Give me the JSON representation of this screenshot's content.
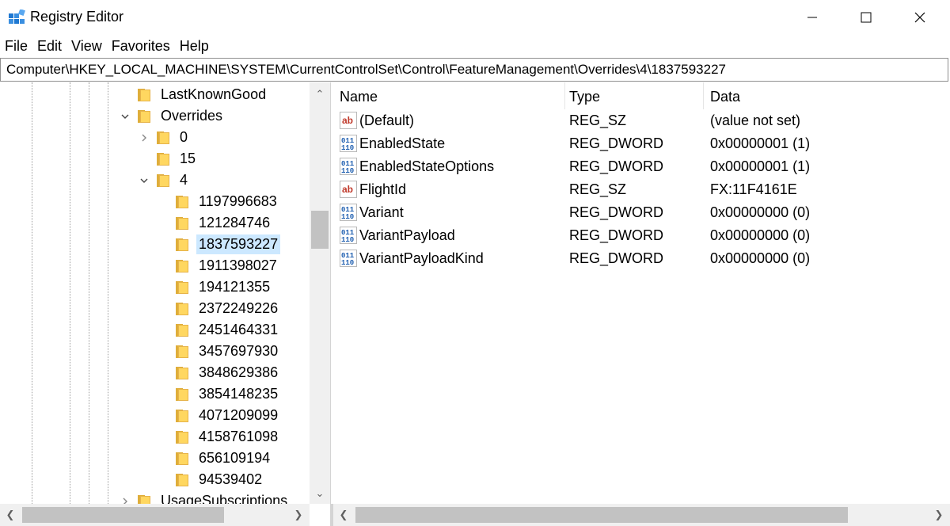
{
  "window": {
    "title": "Registry Editor",
    "minimize_label": "minimize",
    "maximize_label": "maximize",
    "close_label": "close"
  },
  "menu": [
    "File",
    "Edit",
    "View",
    "Favorites",
    "Help"
  ],
  "address": "Computer\\HKEY_LOCAL_MACHINE\\SYSTEM\\CurrentControlSet\\Control\\FeatureManagement\\Overrides\\4\\1837593227",
  "tree": {
    "items": [
      {
        "label": "LastKnownGood",
        "level": 1,
        "expander": "",
        "selected": false
      },
      {
        "label": "Overrides",
        "level": 1,
        "expander": "expanded",
        "selected": false
      },
      {
        "label": "0",
        "level": 2,
        "expander": "collapsed",
        "selected": false
      },
      {
        "label": "15",
        "level": 2,
        "expander": "",
        "selected": false
      },
      {
        "label": "4",
        "level": 2,
        "expander": "expanded",
        "selected": false
      },
      {
        "label": "1197996683",
        "level": 3,
        "expander": "",
        "selected": false
      },
      {
        "label": "121284746",
        "level": 3,
        "expander": "",
        "selected": false
      },
      {
        "label": "1837593227",
        "level": 3,
        "expander": "",
        "selected": true
      },
      {
        "label": "1911398027",
        "level": 3,
        "expander": "",
        "selected": false
      },
      {
        "label": "194121355",
        "level": 3,
        "expander": "",
        "selected": false
      },
      {
        "label": "2372249226",
        "level": 3,
        "expander": "",
        "selected": false
      },
      {
        "label": "2451464331",
        "level": 3,
        "expander": "",
        "selected": false
      },
      {
        "label": "3457697930",
        "level": 3,
        "expander": "",
        "selected": false
      },
      {
        "label": "3848629386",
        "level": 3,
        "expander": "",
        "selected": false
      },
      {
        "label": "3854148235",
        "level": 3,
        "expander": "",
        "selected": false
      },
      {
        "label": "4071209099",
        "level": 3,
        "expander": "",
        "selected": false
      },
      {
        "label": "4158761098",
        "level": 3,
        "expander": "",
        "selected": false
      },
      {
        "label": "656109194",
        "level": 3,
        "expander": "",
        "selected": false
      },
      {
        "label": "94539402",
        "level": 3,
        "expander": "",
        "selected": false
      },
      {
        "label": "UsageSubscriptions",
        "level": 1,
        "expander": "collapsed",
        "selected": false
      }
    ]
  },
  "values": {
    "columns": [
      "Name",
      "Type",
      "Data"
    ],
    "rows": [
      {
        "icon": "string-value-icon",
        "name": "(Default)",
        "type": "REG_SZ",
        "data": "(value not set)"
      },
      {
        "icon": "binary-value-icon",
        "name": "EnabledState",
        "type": "REG_DWORD",
        "data": "0x00000001 (1)"
      },
      {
        "icon": "binary-value-icon",
        "name": "EnabledStateOptions",
        "type": "REG_DWORD",
        "data": "0x00000001 (1)"
      },
      {
        "icon": "string-value-icon",
        "name": "FlightId",
        "type": "REG_SZ",
        "data": "FX:11F4161E"
      },
      {
        "icon": "binary-value-icon",
        "name": "Variant",
        "type": "REG_DWORD",
        "data": "0x00000000 (0)"
      },
      {
        "icon": "binary-value-icon",
        "name": "VariantPayload",
        "type": "REG_DWORD",
        "data": "0x00000000 (0)"
      },
      {
        "icon": "binary-value-icon",
        "name": "VariantPayloadKind",
        "type": "REG_DWORD",
        "data": "0x00000000 (0)"
      }
    ]
  },
  "colors": {
    "selection": "#cce8ff",
    "folder": "#ffd760",
    "scrollbar_track": "#f0f0f0",
    "scrollbar_thumb": "#c2c2c2"
  }
}
